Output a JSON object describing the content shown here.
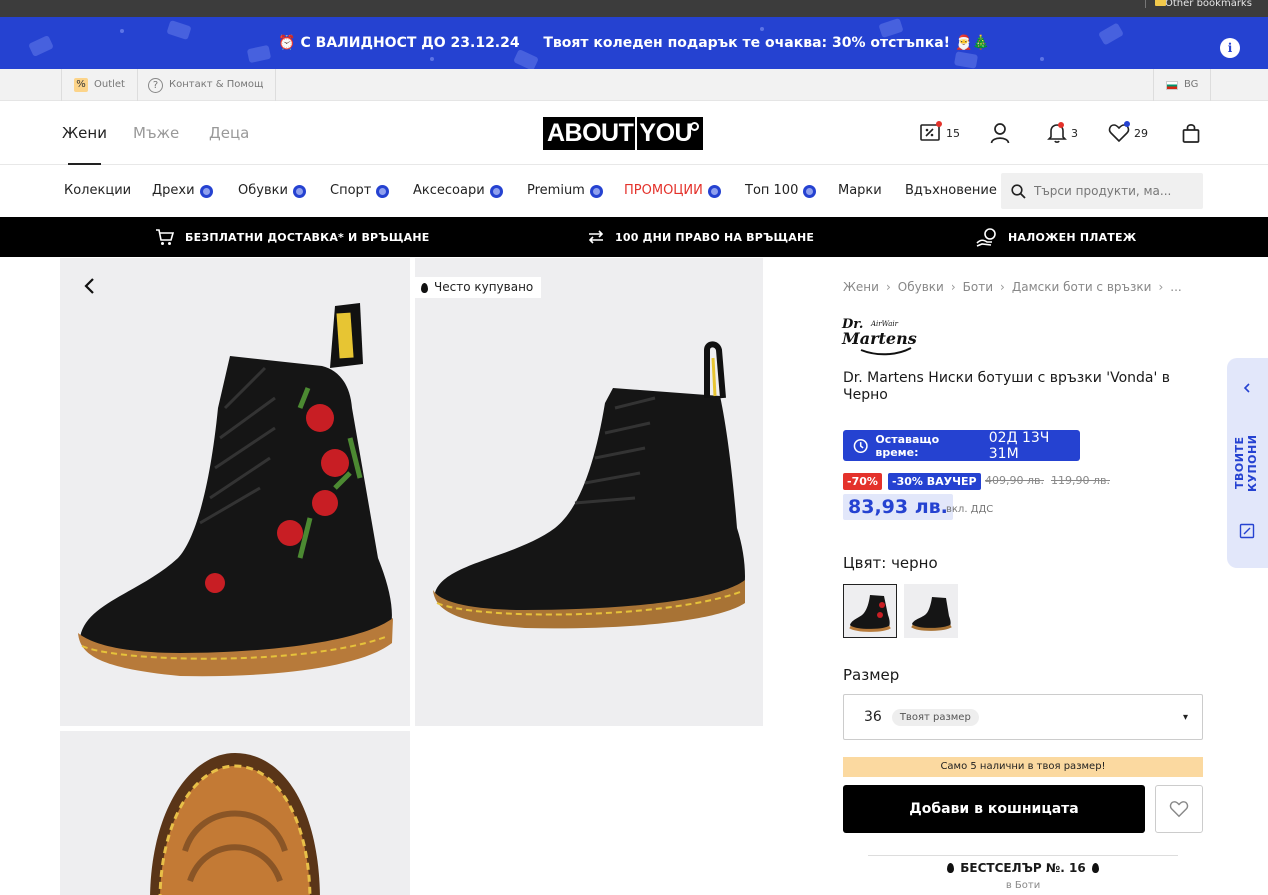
{
  "browser": {
    "bookmark_label": "Other bookmarks"
  },
  "promo_banner": {
    "validity": "С ВАЛИДНОСТ ДО 23.12.24",
    "message": "Твоят коледен подарък те очаква: 30% отстъпка!",
    "info_icon": "info-icon",
    "color": "#2542d1"
  },
  "utility_bar": {
    "outlet": "Outlet",
    "contact": "Контакт & Помощ",
    "country": "BG"
  },
  "header": {
    "genders": [
      "Жени",
      "Мъже",
      "Деца"
    ],
    "logo": {
      "left": "ABOUT",
      "right": "YOU"
    },
    "offers_count": "15",
    "notifications_count": "3",
    "wishlist_count": "29"
  },
  "categories": [
    {
      "label": "Колекции"
    },
    {
      "label": "Дрехи"
    },
    {
      "label": "Обувки"
    },
    {
      "label": "Спорт"
    },
    {
      "label": "Аксесоари"
    },
    {
      "label": "Premium"
    },
    {
      "label": "ПРОМОЦИИ"
    },
    {
      "label": "Топ 100"
    },
    {
      "label": "Марки"
    },
    {
      "label": "Вдъхновение"
    }
  ],
  "search": {
    "placeholder": "Търси продукти, ма..."
  },
  "benefits": [
    "БЕЗПЛАТНИ ДОСТАВКА* И ВРЪЩАНЕ",
    "100 ДНИ ПРАВО НА ВРЪЩАНЕ",
    "НАЛОЖЕН ПЛАТЕЖ"
  ],
  "gallery": {
    "often_bought_tag": "Често купувано"
  },
  "product": {
    "breadcrumb": [
      "Жени",
      "Обувки",
      "Боти",
      "Дамски боти с връзки",
      "..."
    ],
    "brand": "Dr. Martens",
    "name": "Dr. Martens Ниски ботуши с връзки 'Vonda' в Черно",
    "timer_label": "Оставащо време:",
    "timer_value": "02Д 13Ч 31М",
    "discount_chip": "-70%",
    "voucher_chip": "-30% ВАУЧЕР",
    "old_price_1": "409,90 лв.",
    "old_price_2": "119,90 лв.",
    "price": "83,93 лв.",
    "vat_note": "вкл. ДДС",
    "color_label": "Цвят: черно",
    "size_label": "Размер",
    "size_value": "36",
    "your_size": "Твоят размер",
    "stock_note": "Само 5 налични в твоя размер!",
    "add_to_cart": "Добави в кошницата",
    "bestseller": "БЕСТСЕЛЪР №. 16",
    "bestseller_sub": "в Боти"
  },
  "coupon_tab": {
    "label": "ТВОИТЕ КУПОНИ"
  },
  "colors": {
    "accent_blue": "#2542d1",
    "promo_red": "#e4322b",
    "stock_bg": "#fbd9a0",
    "discount_red": "#e4322b"
  }
}
